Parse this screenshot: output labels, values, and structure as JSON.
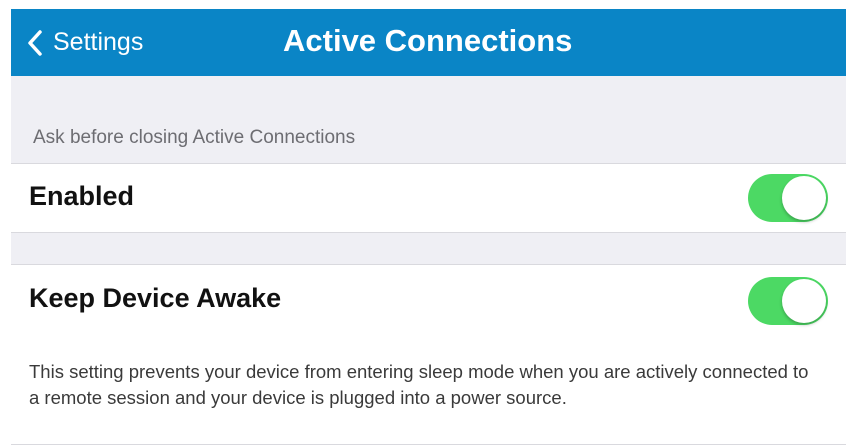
{
  "navbar": {
    "back_label": "Settings",
    "back_icon": "chevron-left-icon",
    "title": "Active Connections"
  },
  "section": {
    "header": "Ask before closing Active Connections"
  },
  "settings": {
    "enabled": {
      "label": "Enabled",
      "toggle_on": true
    },
    "keep_awake": {
      "label": "Keep Device Awake",
      "toggle_on": true,
      "description": "This setting prevents your device from entering sleep mode when you are actively connected to a remote session and your device is plugged into a power source."
    }
  },
  "colors": {
    "navbar": "#0a85c6",
    "toggle_on": "#4cd964",
    "background": "#efeff4"
  }
}
